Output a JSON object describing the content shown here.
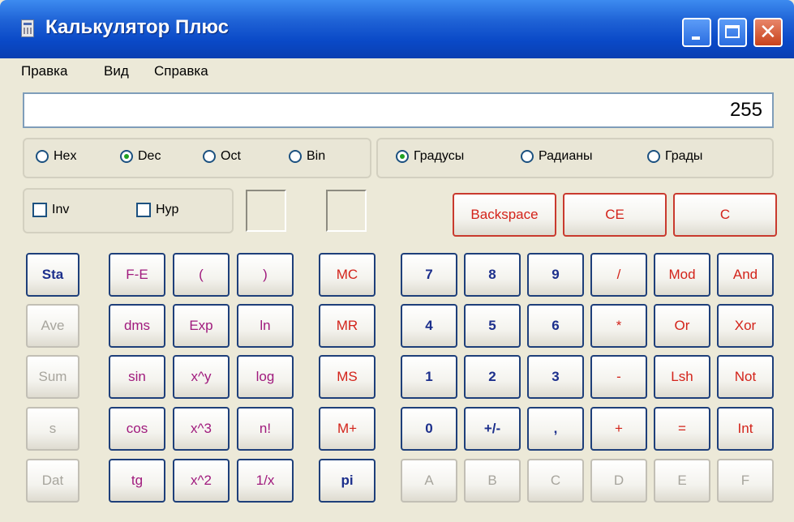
{
  "window": {
    "title": "Калькулятор Плюс",
    "minimize_icon": "minimize-icon",
    "maximize_icon": "maximize-icon",
    "close_glyph": "✕"
  },
  "menu": [
    "Правка",
    "Вид",
    "Справка"
  ],
  "display": {
    "value": "255"
  },
  "base_radios": [
    {
      "label": "Hex",
      "checked": false
    },
    {
      "label": "Dec",
      "checked": true
    },
    {
      "label": "Oct",
      "checked": false
    },
    {
      "label": "Bin",
      "checked": false
    }
  ],
  "angle_radios": [
    {
      "label": "Градусы",
      "checked": true
    },
    {
      "label": "Радианы",
      "checked": false
    },
    {
      "label": "Грады",
      "checked": false
    }
  ],
  "checks": [
    {
      "label": "Inv",
      "checked": false
    },
    {
      "label": "Hyp",
      "checked": false
    }
  ],
  "edit_buttons": [
    "Backspace",
    "CE",
    "C"
  ],
  "stat_buttons": [
    "Sta",
    "Ave",
    "Sum",
    "s",
    "Dat"
  ],
  "sci_buttons": [
    [
      "F-E",
      "(",
      ")"
    ],
    [
      "dms",
      "Exp",
      "ln"
    ],
    [
      "sin",
      "x^y",
      "log"
    ],
    [
      "cos",
      "x^3",
      "n!"
    ],
    [
      "tg",
      "x^2",
      "1/x"
    ]
  ],
  "memory_buttons": [
    "MC",
    "MR",
    "MS",
    "M+",
    "pi"
  ],
  "main_buttons": [
    [
      "7",
      "8",
      "9",
      "/",
      "Mod",
      "And"
    ],
    [
      "4",
      "5",
      "6",
      "*",
      "Or",
      "Xor"
    ],
    [
      "1",
      "2",
      "3",
      "-",
      "Lsh",
      "Not"
    ],
    [
      "0",
      "+/-",
      ",",
      "+",
      "=",
      "Int"
    ],
    [
      "A",
      "B",
      "C",
      "D",
      "E",
      "F"
    ]
  ],
  "colors": {
    "title_blue": "#0a49c7",
    "button_blue_text": "#1c2f8c",
    "button_purple_text": "#a01a7d",
    "button_red_text": "#d3231a",
    "disabled_text": "#a7a59d"
  }
}
